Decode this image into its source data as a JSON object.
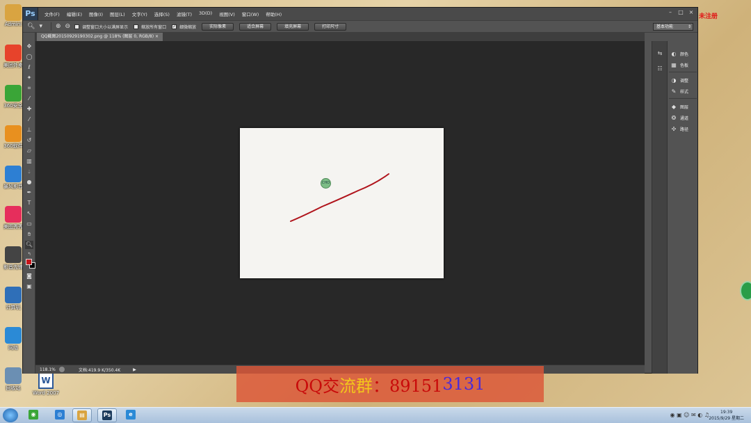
{
  "desktop": {
    "icons": [
      {
        "label": "Admini",
        "color": "#d9a441"
      },
      {
        "label": "美团外卖",
        "color": "#e7432b"
      },
      {
        "label": "360安全",
        "color": "#3aa537"
      },
      {
        "label": "360软件",
        "color": "#e8901f"
      },
      {
        "label": "暴风影音",
        "color": "#2d7fd3"
      },
      {
        "label": "美图秀秀",
        "color": "#e62e5c"
      },
      {
        "label": "影音先锋",
        "color": "#444444"
      },
      {
        "label": "计算机",
        "color": "#2f6fb8"
      },
      {
        "label": "网络",
        "color": "#2b8ad6"
      },
      {
        "label": "回收站",
        "color": "#6b8fb3"
      }
    ],
    "word_icon": {
      "glyph": "W",
      "label": "Word 2007"
    },
    "watermark": "湖南专家 未注册"
  },
  "photoshop": {
    "logo": "Ps",
    "menu": [
      "文件(F)",
      "编辑(E)",
      "图像(I)",
      "图层(L)",
      "文字(Y)",
      "选择(S)",
      "滤镜(T)",
      "3D(D)",
      "视图(V)",
      "窗口(W)",
      "帮助(H)"
    ],
    "window_controls": [
      "–",
      "□",
      "×"
    ],
    "options": {
      "checkbox_resize": "调整窗口大小以满屏显示",
      "checkbox_all_windows": "缩放所有窗口",
      "checkbox_scrubby": "细微缩放",
      "btn_actual_pixels": "实际像素",
      "btn_fit_screen": "适合屏幕",
      "btn_fill_screen": "填充屏幕",
      "btn_print_size": "打印尺寸",
      "workspace": "基本功能"
    },
    "document_tab": "QQ截图20150929190302.png @ 118% (图层 0, RGB/8) ×",
    "status": {
      "zoom": "118.1%",
      "doc_info": "文档:419.9 K/350.4K",
      "arrow": "▶"
    },
    "panels": [
      {
        "icon": "◐",
        "label": "颜色"
      },
      {
        "icon": "▦",
        "label": "色板"
      },
      {
        "icon": "◑",
        "label": "调整"
      },
      {
        "icon": "✎",
        "label": "样式"
      },
      {
        "icon": "◆",
        "label": "图层"
      },
      {
        "icon": "❂",
        "label": "通道"
      },
      {
        "icon": "✣",
        "label": "路径"
      }
    ],
    "colors": {
      "foreground": "#c8151a",
      "background": "#000000",
      "stroke": "#b0141c"
    },
    "brush_cursor_label": "CHO"
  },
  "banner": {
    "part1": "QQ交",
    "part2": "流群",
    "part3": "：89151",
    "part4": "3131"
  },
  "taskbar": {
    "apps": [
      {
        "glyph": "◉",
        "color": "#3aa537"
      },
      {
        "glyph": "◎",
        "color": "#2d7fd3"
      },
      {
        "glyph": "▤",
        "color": "#d9a441"
      },
      {
        "glyph": "Ps",
        "color": "#1c3b5c"
      },
      {
        "glyph": "e",
        "color": "#2b8ad6"
      }
    ],
    "tray": "◉ ▣ ☺ ✉ ◐ ♫",
    "time": "19:39",
    "date": "2015/9/29 星期二"
  }
}
